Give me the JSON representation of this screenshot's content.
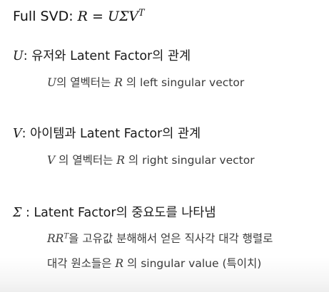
{
  "full_svd": {
    "label": "Full SVD: ",
    "formula_lhs": "R",
    "formula_eq": " = ",
    "formula_rhs": "UΣV",
    "formula_sup": "T"
  },
  "u_section": {
    "symbol": "U",
    "heading": ": 유저와 Latent Factor의 관계",
    "desc_symbol": "U",
    "desc_mid": "의 열벡터는 ",
    "desc_symbol2": "R",
    "desc_end": " 의 left singular vector"
  },
  "v_section": {
    "symbol": "V",
    "heading": ": 아이템과 Latent Factor의 관계",
    "desc_symbol": "V",
    "desc_mid": " 의 열벡터는 ",
    "desc_symbol2": "R",
    "desc_end": " 의 right singular vector"
  },
  "sigma_section": {
    "symbol": "Σ",
    "heading": " : Latent Factor의 중요도를 나타냄",
    "line1_symbol": "RR",
    "line1_sup": "T",
    "line1_text": "을 고유값 분해해서 얻은 직사각 대각 행렬로",
    "line2_start": "대각 원소들은 ",
    "line2_symbol": "R",
    "line2_end": " 의 singular value (특이치)"
  }
}
